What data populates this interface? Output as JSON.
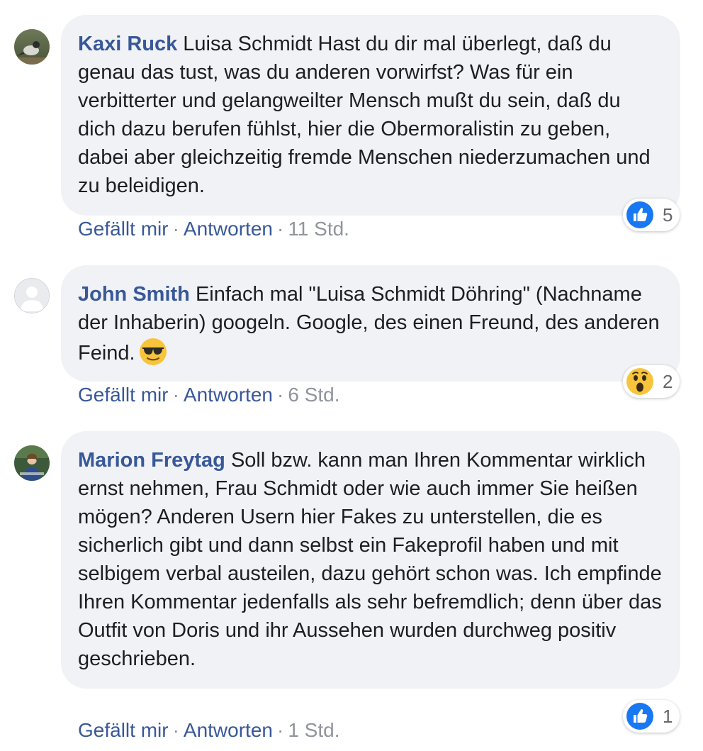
{
  "comments": [
    {
      "author": "Kaxi Ruck",
      "text": "Luisa Schmidt Hast du dir mal überlegt, daß du genau das tust, was du anderen vorwirfst? Was für ein verbitterter und gelangweilter Mensch mußt du sein, daß du dich dazu berufen fühlst, hier die Obermoralistin zu geben, dabei aber gleichzeitig fremde Menschen niederzumachen und zu beleidigen.",
      "like_label": "Gefällt mir",
      "reply_label": "Antworten",
      "separator": "·",
      "time": "11 Std.",
      "reaction_type": "like",
      "reaction_count": "5"
    },
    {
      "author": "John Smith",
      "text": "Einfach mal \"Luisa Schmidt Döhring\" (Nachname der Inhaberin) googeln. Google, des einen Freund, des anderen Feind.",
      "emoji": "sunglasses-face",
      "like_label": "Gefällt mir",
      "reply_label": "Antworten",
      "separator": "·",
      "time": "6 Std.",
      "reaction_type": "wow",
      "reaction_count": "2"
    },
    {
      "author": "Marion Freytag",
      "text": "Soll bzw. kann man Ihren Kommentar wirklich ernst nehmen, Frau Schmidt oder wie auch immer Sie heißen mögen? Anderen Usern hier Fakes zu unterstellen, die es sicherlich gibt und dann selbst ein Fakeprofil haben und mit selbigem verbal austeilen, dazu gehört schon was. Ich empfinde Ihren Kommentar jedenfalls als sehr befremdlich; denn über das Outfit von Doris und ihr Aussehen wurden durchweg positiv geschrieben.",
      "like_label": "Gefällt mir",
      "reply_label": "Antworten",
      "separator": "·",
      "time": "1 Std.",
      "reaction_type": "like",
      "reaction_count": "1"
    }
  ],
  "colors": {
    "author": "#385898",
    "bubble": "#f0f2f5",
    "meta": "#90949c",
    "like_blue": "#1877f2"
  }
}
